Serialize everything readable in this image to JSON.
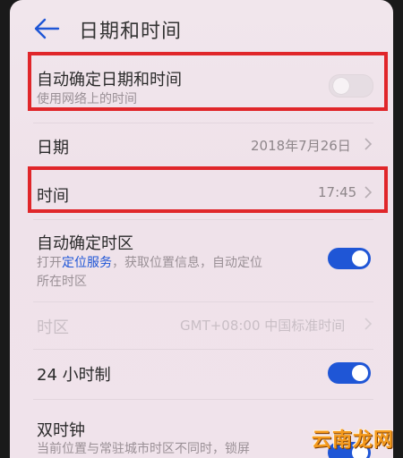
{
  "header": {
    "title": "日期和时间"
  },
  "auto_datetime": {
    "label": "自动确定日期和时间",
    "sublabel": "使用网络上的时间",
    "enabled": false
  },
  "date": {
    "label": "日期",
    "value": "2018年7月26日"
  },
  "time": {
    "label": "时间",
    "value": "17:45"
  },
  "auto_timezone": {
    "label": "自动确定时区",
    "sub_prefix": "打开",
    "sub_link": "定位服务",
    "sub_suffix": "，获取位置信息，自动定位",
    "sub_line2": "所在时区",
    "enabled": true
  },
  "timezone": {
    "label": "时区",
    "value": "GMT+08:00 中国标准时间",
    "disabled": true
  },
  "hour24": {
    "label": "24 小时制",
    "enabled": true
  },
  "dual_clock": {
    "label": "双时钟",
    "sublabel": "当前位置与常驻城市时区不同时，锁屏",
    "enabled": true
  },
  "watermark": {
    "text": "云南龙网"
  },
  "colors": {
    "accent": "#1f56d6",
    "highlight": "#e0262a"
  }
}
